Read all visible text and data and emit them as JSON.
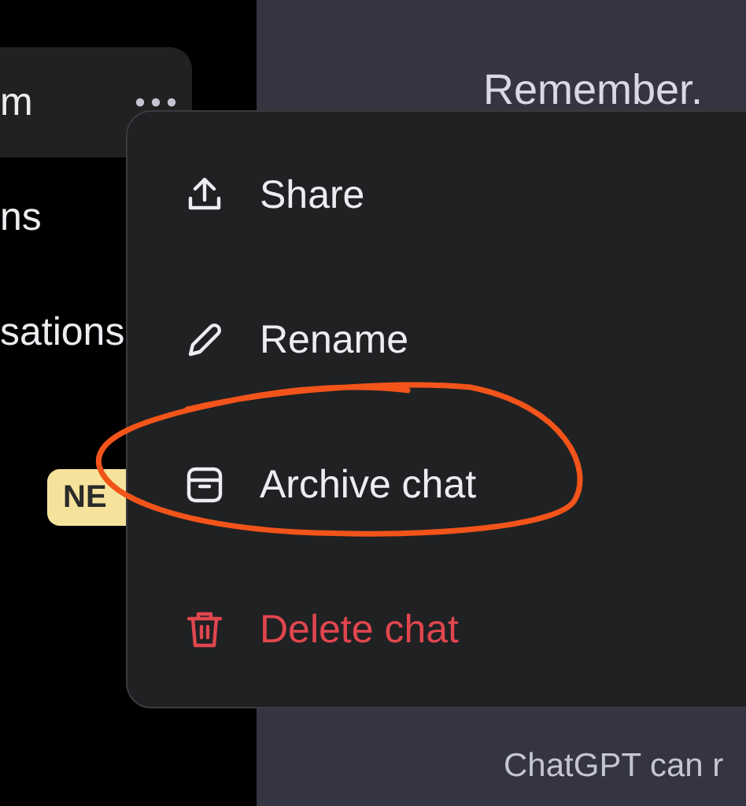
{
  "sidebar": {
    "items": [
      {
        "label": "m",
        "selected": true
      },
      {
        "label": "ns",
        "selected": false
      },
      {
        "label": "sations",
        "selected": false
      }
    ],
    "badge": "NE"
  },
  "main": {
    "heading": "Remember.",
    "footer": "ChatGPT can r"
  },
  "menu": {
    "items": [
      {
        "label": "Share",
        "kind": "normal",
        "circled": false
      },
      {
        "label": "Rename",
        "kind": "normal",
        "circled": false
      },
      {
        "label": "Archive chat",
        "kind": "normal",
        "circled": true
      },
      {
        "label": "Delete chat",
        "kind": "danger",
        "circled": false
      }
    ]
  }
}
